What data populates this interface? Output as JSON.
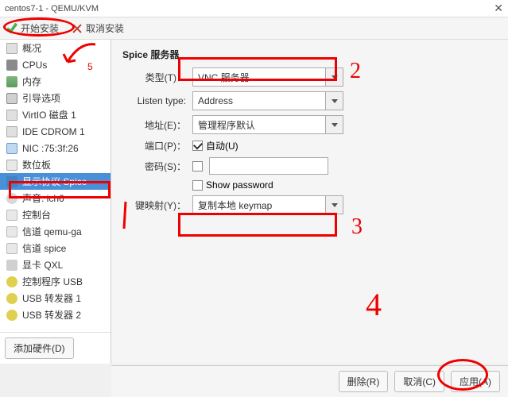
{
  "window": {
    "title": "centos7-1 - QEMU/KVM"
  },
  "toolbar": {
    "begin_install": "开始安装",
    "cancel_install": "取消安装"
  },
  "sidebar": {
    "items": [
      {
        "label": "概况",
        "ico": "disk"
      },
      {
        "label": "CPUs",
        "ico": "cpu"
      },
      {
        "label": "内存",
        "ico": "mem"
      },
      {
        "label": "引导选项",
        "ico": "boot"
      },
      {
        "label": "VirtIO 磁盘 1",
        "ico": "disk"
      },
      {
        "label": "IDE CDROM 1",
        "ico": "disk"
      },
      {
        "label": "NIC :75:3f:26",
        "ico": "net"
      },
      {
        "label": "数位板",
        "ico": "tablet"
      },
      {
        "label": "显示协议 Spice",
        "ico": "display",
        "sel": true
      },
      {
        "label": "声音: ich6",
        "ico": "sound"
      },
      {
        "label": "控制台",
        "ico": "serial"
      },
      {
        "label": "信道 qemu-ga",
        "ico": "serial"
      },
      {
        "label": "信道 spice",
        "ico": "serial"
      },
      {
        "label": "显卡 QXL",
        "ico": "video"
      },
      {
        "label": "控制程序 USB",
        "ico": "usb"
      },
      {
        "label": "USB 转发器 1",
        "ico": "usb"
      },
      {
        "label": "USB 转发器 2",
        "ico": "usb"
      }
    ],
    "add_hw": "添加硬件(D)"
  },
  "panel": {
    "title": "Spice 服务器",
    "type_label": "类型(T)：",
    "type_value": "VNC 服务器",
    "listen_label": "Listen type:",
    "listen_value": "Address",
    "addr_label": "地址(E)：",
    "addr_value": "管理程序默认",
    "port_label": "端口(P)：",
    "port_auto": "自动(U)",
    "pass_label": "密码(S)：",
    "showpw": "Show password",
    "keymap_label": "键映射(Y)：",
    "keymap_value": "复制本地 keymap"
  },
  "footer": {
    "delete": "删除(R)",
    "cancel": "取消(C)",
    "apply": "应用(A)"
  },
  "annotations": {
    "n2": "2",
    "n3": "3",
    "n4": "4"
  }
}
